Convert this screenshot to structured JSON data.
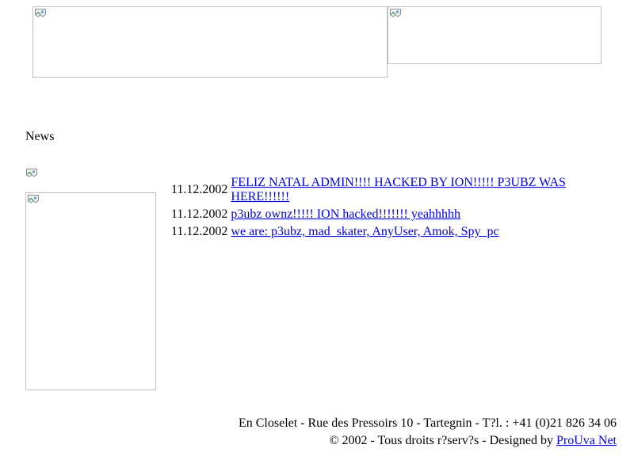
{
  "news": {
    "heading": "News",
    "items": [
      {
        "date": "11.12.2002",
        "text": "FELIZ NATAL ADMIN!!!! HACKED BY ION!!!!! P3UBZ WAS HERE!!!!!!"
      },
      {
        "date": "11.12.2002",
        "text": "p3ubz ownz!!!!! ION hacked!!!!!!! yeahhhhh"
      },
      {
        "date": "11.12.2002",
        "text": "we are: p3ubz, mad_skater, AnyUser, Amok, Spy_pc"
      }
    ]
  },
  "footer": {
    "address": "En Closelet - Rue des Pressoirs 10 - Tartegnin - T?l. : +41 (0)21 826 34 06",
    "copyright": "© 2002 - Tous droits r?serv?s - Designed by",
    "designer_link": "ProUva Net"
  },
  "colors": {
    "link": "#0000ee",
    "image_border": "#c0c0c0"
  },
  "icons": {
    "placeholder": "broken-image-icon"
  }
}
